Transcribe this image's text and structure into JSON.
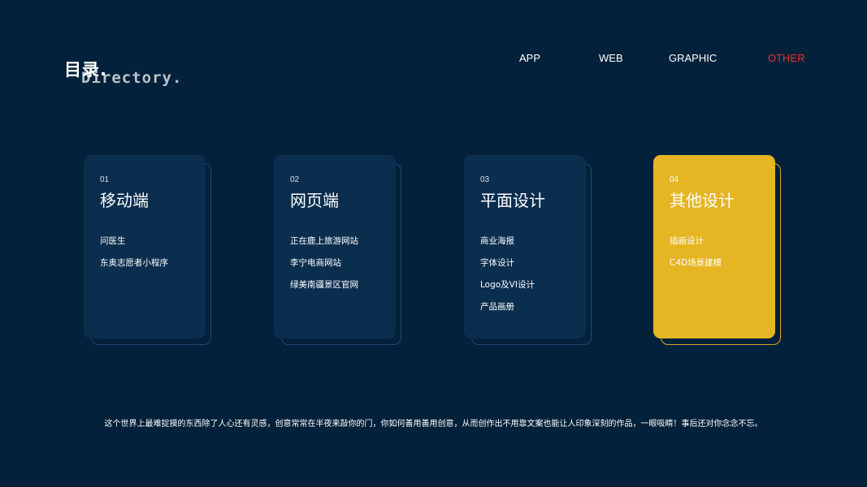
{
  "header": {
    "title_cn": "目录.",
    "title_en": "Directory."
  },
  "nav": {
    "items": [
      {
        "label": "APP"
      },
      {
        "label": "WEB"
      },
      {
        "label": "GRAPHIC"
      },
      {
        "label": "OTHER",
        "active": true
      }
    ],
    "active_color": "#e8312c"
  },
  "colors": {
    "background": "#03213a",
    "card": "#0b2e4f",
    "card_highlight": "#e5b524"
  },
  "cards": [
    {
      "num": "01",
      "title": "移动端",
      "items": [
        "问医生",
        "东奥志愿者小程序"
      ]
    },
    {
      "num": "02",
      "title": "网页端",
      "items": [
        "正在鹿上旅游网站",
        "李宁电商网站",
        "绿美南疆景区官网"
      ]
    },
    {
      "num": "03",
      "title": "平面设计",
      "items": [
        "商业海报",
        "字体设计",
        "Logo及VI设计",
        "产品画册"
      ]
    },
    {
      "num": "04",
      "title": "其他设计",
      "items": [
        "插画设计",
        "C4D场景建模"
      ],
      "highlight": true
    }
  ],
  "footer": {
    "text": "这个世界上最难捉摸的东西除了人心还有灵感，创意常常在半夜来敲你的门，你如何善用善用创意，从而创作出不用靠文案也能让人印象深刻的作品，一眼吸睛！事后还对你念念不忘。"
  }
}
